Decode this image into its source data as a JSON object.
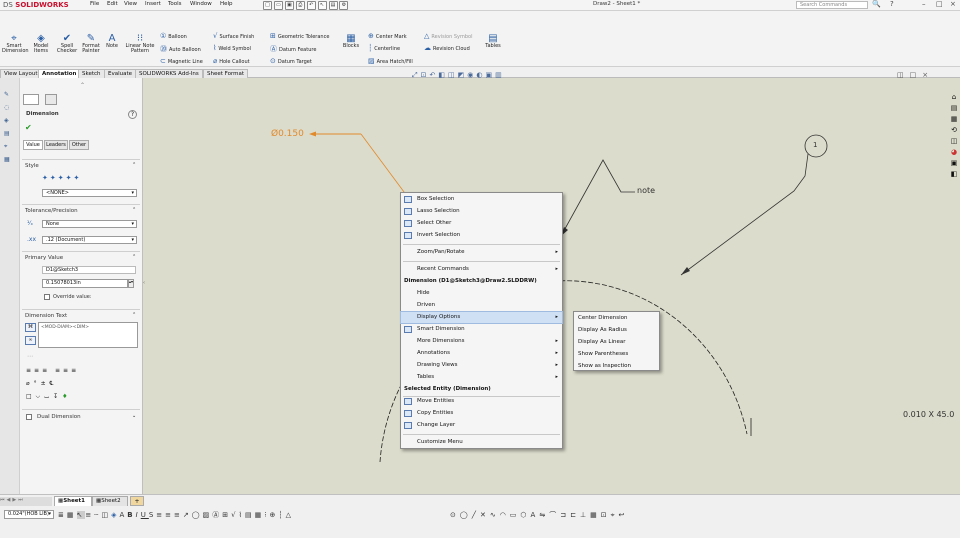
{
  "app": {
    "name": "SOLIDWORKS",
    "brand_prefix": "DS",
    "window_title": "Draw2 - Sheet1 *"
  },
  "menubar": [
    "File",
    "Edit",
    "View",
    "Insert",
    "Tools",
    "Window",
    "Help"
  ],
  "search": {
    "placeholder": "Search Commands"
  },
  "ribbon": {
    "big_buttons": [
      "Smart Dimension",
      "Model Items",
      "Spell Checker",
      "Format Painter",
      "Note",
      "Linear Note Pattern"
    ],
    "col1": [
      "Balloon",
      "Auto Balloon",
      "Magnetic Line"
    ],
    "col2": [
      "Surface Finish",
      "Weld Symbol",
      "Hole Callout"
    ],
    "col3": [
      "Geometric Tolerance",
      "Datum Feature",
      "Datum Target"
    ],
    "blocks": "Blocks",
    "col4": [
      "Center Mark",
      "Centerline",
      "Area Hatch/Fill"
    ],
    "col5": [
      "Revision Symbol",
      "Revision Cloud"
    ],
    "tables": "Tables"
  },
  "command_tabs": [
    "View Layout",
    "Annotation",
    "Sketch",
    "Evaluate",
    "SOLIDWORKS Add-Ins",
    "Sheet Format"
  ],
  "active_tab": "Annotation",
  "property_manager": {
    "title": "Dimension",
    "subtabs": [
      "Value",
      "Leaders",
      "Other"
    ],
    "style_label": "Style",
    "style_value": "<NONE>",
    "tolerance_label": "Tolerance/Precision",
    "tolerance_value": "None",
    "precision_value": ".12 (Document)",
    "primary_label": "Primary Value",
    "primary_name": "D1@Sketch3",
    "primary_value": "0.15078013in",
    "override_label": "Override value:",
    "dimtext_label": "Dimension Text",
    "dimtext_value": "<MOD-DIAM><DIM>",
    "dual_label": "Dual Dimension"
  },
  "drawing": {
    "dim_text": "Ø0.150",
    "note_text": "note",
    "balloon_text": "1",
    "right_text": "0.010 X 45.0"
  },
  "context_menu": {
    "items_top": [
      "Box Selection",
      "Lasso Selection",
      "Select Other",
      "Invert Selection"
    ],
    "zoom": "Zoom/Pan/Rotate",
    "recent": "Recent Commands",
    "dim_header": "Dimension (D1@Sketch3@Draw2.SLDDRW)",
    "dim_items": [
      "Hide",
      "Driven",
      "Display Options",
      "Smart Dimension",
      "More Dimensions",
      "Annotations",
      "Drawing Views",
      "Tables"
    ],
    "entity_header": "Selected Entity (Dimension)",
    "entity_items": [
      "Move Entities",
      "Copy Entities",
      "Change Layer"
    ],
    "customize": "Customize Menu"
  },
  "submenu": [
    "Center Dimension",
    "Display As Radius",
    "Display As Linear",
    "Show Parentheses",
    "Show as Inspection"
  ],
  "sheet_tabs": [
    "Sheet1",
    "Sheet2"
  ],
  "layer_combo": "0.024\"(HOB LIB)"
}
